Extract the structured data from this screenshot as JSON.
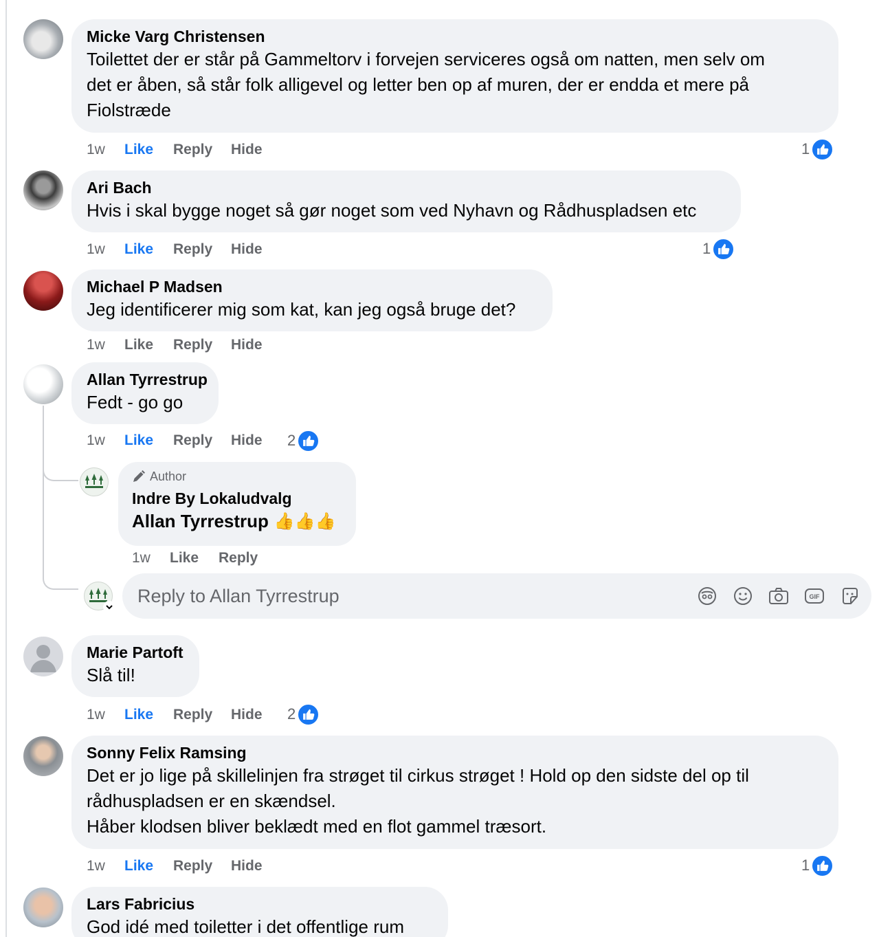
{
  "comments": [
    {
      "author": "Micke Varg Christensen",
      "lines": [
        "Toilettet der er står på Gammeltorv i forvejen serviceres også om natten, men selv om",
        "det er åben, så står folk alligevel og letter ben op af muren, der er endda et mere på",
        "Fiolstræde"
      ],
      "time": "1w",
      "like": "Like",
      "reply": "Reply",
      "hide": "Hide",
      "reactions": "1"
    },
    {
      "author": "Ari Bach",
      "lines": [
        "Hvis i skal bygge noget så gør noget som ved Nyhavn og Rådhuspladsen etc"
      ],
      "time": "1w",
      "like": "Like",
      "reply": "Reply",
      "hide": "Hide",
      "reactions": "1"
    },
    {
      "author": "Michael P Madsen",
      "lines": [
        "Jeg identificerer mig som kat, kan jeg også bruge det?"
      ],
      "time": "1w",
      "like": "Like",
      "reply": "Reply",
      "hide": "Hide"
    },
    {
      "author": "Allan Tyrrestrup",
      "lines": [
        "Fedt - go go"
      ],
      "time": "1w",
      "like": "Like",
      "reply": "Reply",
      "hide": "Hide",
      "reactions": "2"
    },
    {
      "author": "Marie Partoft",
      "lines": [
        "Slå til!"
      ],
      "time": "1w",
      "like": "Like",
      "reply": "Reply",
      "hide": "Hide",
      "reactions": "2"
    },
    {
      "author": "Sonny Felix Ramsing",
      "lines": [
        "Det er jo lige på skillelinjen fra strøget til cirkus strøget ! Hold op den sidste del op til",
        "rådhuspladsen er en skændsel.",
        "Håber klodsen bliver beklædt med en flot gammel træsort."
      ],
      "time": "1w",
      "like": "Like",
      "reply": "Reply",
      "hide": "Hide",
      "reactions": "1"
    },
    {
      "author": "Lars Fabricius",
      "lines": [
        "God idé med toiletter i det offentlige rum"
      ]
    }
  ],
  "nested_reply": {
    "badge": "Author",
    "author": "Indre By Lokaludvalg",
    "mention": "Allan Tyrrestrup",
    "emoji": "👍👍👍",
    "time": "1w",
    "like": "Like",
    "reply": "Reply"
  },
  "reply_box": {
    "placeholder": "Reply to Allan Tyrrestrup",
    "tools": [
      "avatar-sticker-icon",
      "emoji-icon",
      "camera-icon",
      "gif-icon",
      "sticker-icon"
    ]
  },
  "colors": {
    "bubble": "#f0f2f5",
    "like_active": "#1877f2",
    "secondary_text": "#65676b"
  }
}
